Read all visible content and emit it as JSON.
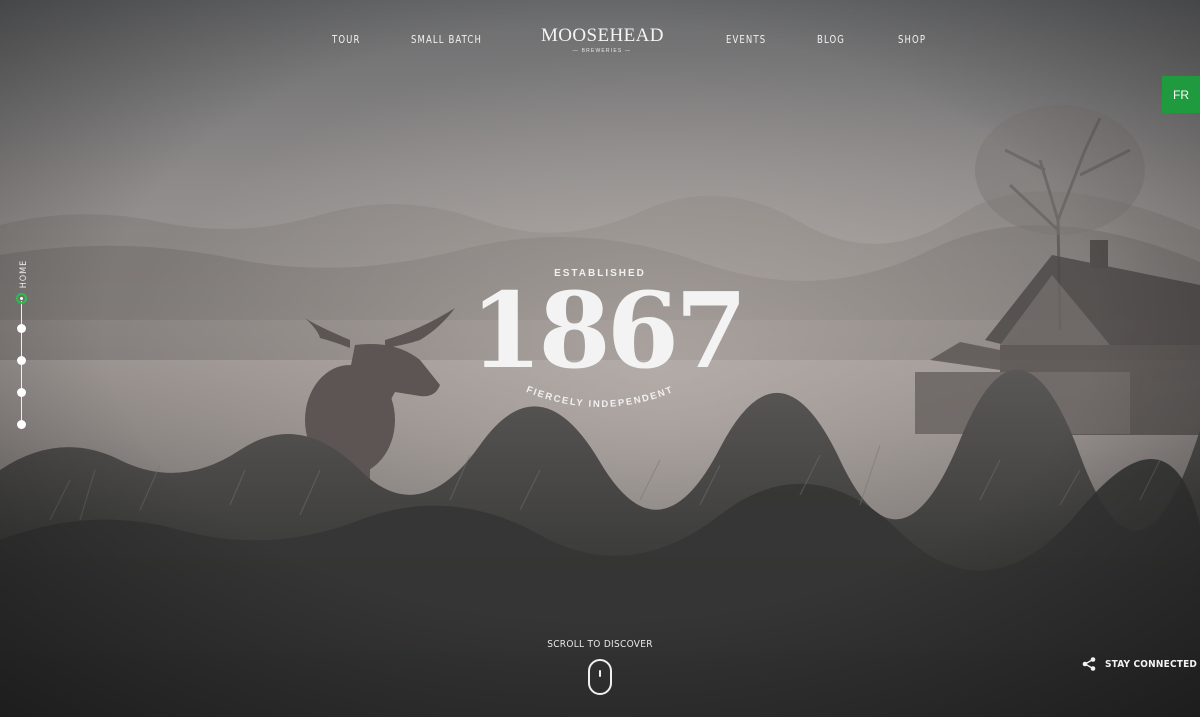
{
  "nav": {
    "left": [
      "TOUR",
      "SMALL BATCH"
    ],
    "right": [
      "EVENTS",
      "BLOG",
      "SHOP"
    ]
  },
  "logo": {
    "name": "MOOSEHEAD",
    "subtitle": "— BREWERIES —"
  },
  "language": {
    "label": "FR",
    "color": "#1f9a3f"
  },
  "side_nav": {
    "label": "HOME",
    "active_index": 0,
    "dot_count": 5,
    "accent": "#2bbd50"
  },
  "hero": {
    "established": "ESTABLISHED",
    "year": "1867",
    "tagline": "FIERCELY INDEPENDENT"
  },
  "scroll": {
    "label": "SCROLL TO DISCOVER"
  },
  "footer": {
    "stay_connected": "STAY CONNECTED",
    "icon": "share-icon"
  }
}
